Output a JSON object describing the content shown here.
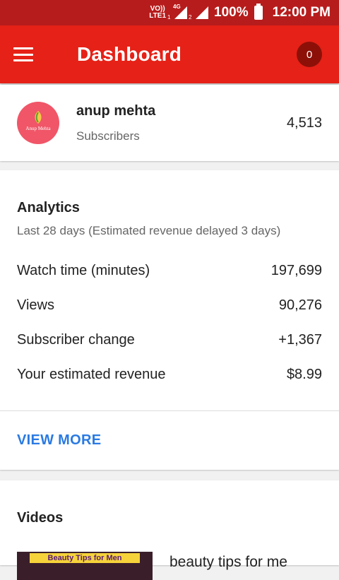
{
  "status_bar": {
    "carrier_top": "VO))",
    "carrier_bottom": "LTE1",
    "network": "4G",
    "sim1": "1",
    "sim2": "2",
    "battery": "100%",
    "time": "12:00 PM"
  },
  "app_bar": {
    "title": "Dashboard",
    "notification_count": "0",
    "menu_icon": "hamburger-menu-icon"
  },
  "channel": {
    "name": "anup mehta",
    "subscribers_label": "Subscribers",
    "subscribers_count": "4,513",
    "avatar_text": "Anup Mehta"
  },
  "analytics": {
    "title": "Analytics",
    "subtitle": "Last 28 days (Estimated revenue delayed 3 days)",
    "metrics": [
      {
        "label": "Watch time (minutes)",
        "value": "197,699"
      },
      {
        "label": "Views",
        "value": "90,276"
      },
      {
        "label": "Subscriber change",
        "value": "+1,367"
      },
      {
        "label": "Your estimated revenue",
        "value": "$8.99"
      }
    ],
    "view_more": "VIEW MORE"
  },
  "videos": {
    "title": "Videos",
    "items": [
      {
        "thumbnail_text": "Beauty Tips for Men",
        "title": "beauty tips for me"
      }
    ]
  },
  "colors": {
    "status_bar": "#b71c1c",
    "app_bar": "#e62117",
    "accent_link": "#2a7ae2",
    "avatar": "#f05668"
  }
}
